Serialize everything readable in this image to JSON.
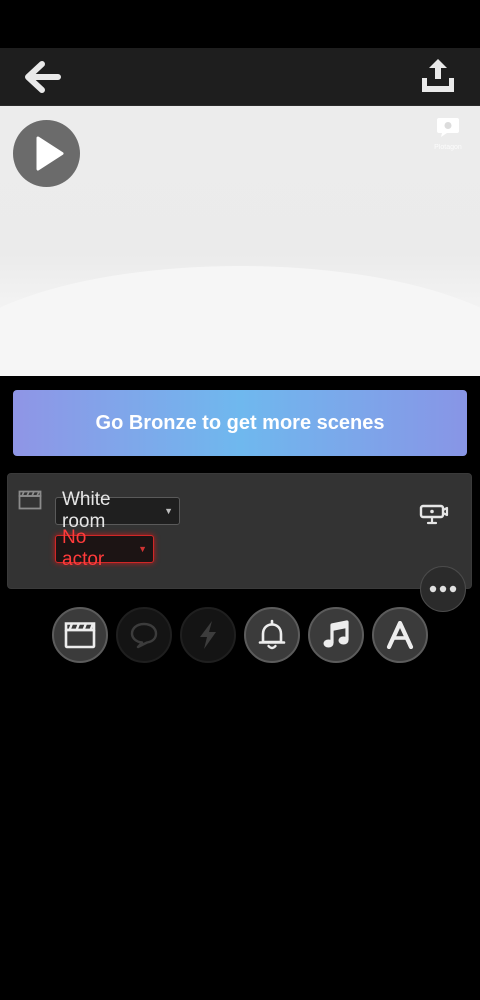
{
  "header": {
    "back_icon": "arrow-left-icon",
    "share_icon": "share-upload-icon"
  },
  "preview": {
    "background": "White room",
    "play_icon": "play-icon",
    "watermark_label": "Plotagon"
  },
  "upgrade": {
    "label": "Go Bronze to get more scenes"
  },
  "scene": {
    "icon": "clapperboard-icon",
    "location": "White room",
    "actor": "No actor",
    "camera_icon": "camera-icon",
    "more_icon": "more-dots-icon"
  },
  "toolbar": {
    "items": [
      {
        "name": "scene",
        "icon": "clapperboard-icon",
        "enabled": true
      },
      {
        "name": "dialogue",
        "icon": "speech-bubble-icon",
        "enabled": false
      },
      {
        "name": "action",
        "icon": "lightning-icon",
        "enabled": false
      },
      {
        "name": "sound-effect",
        "icon": "bell-icon",
        "enabled": true
      },
      {
        "name": "music",
        "icon": "music-note-icon",
        "enabled": true
      },
      {
        "name": "text",
        "icon": "text-a-icon",
        "enabled": true
      }
    ]
  },
  "colors": {
    "accent_error": "#ff3b3b",
    "bar_bg": "#1e1e1e",
    "card_bg": "#333333"
  }
}
